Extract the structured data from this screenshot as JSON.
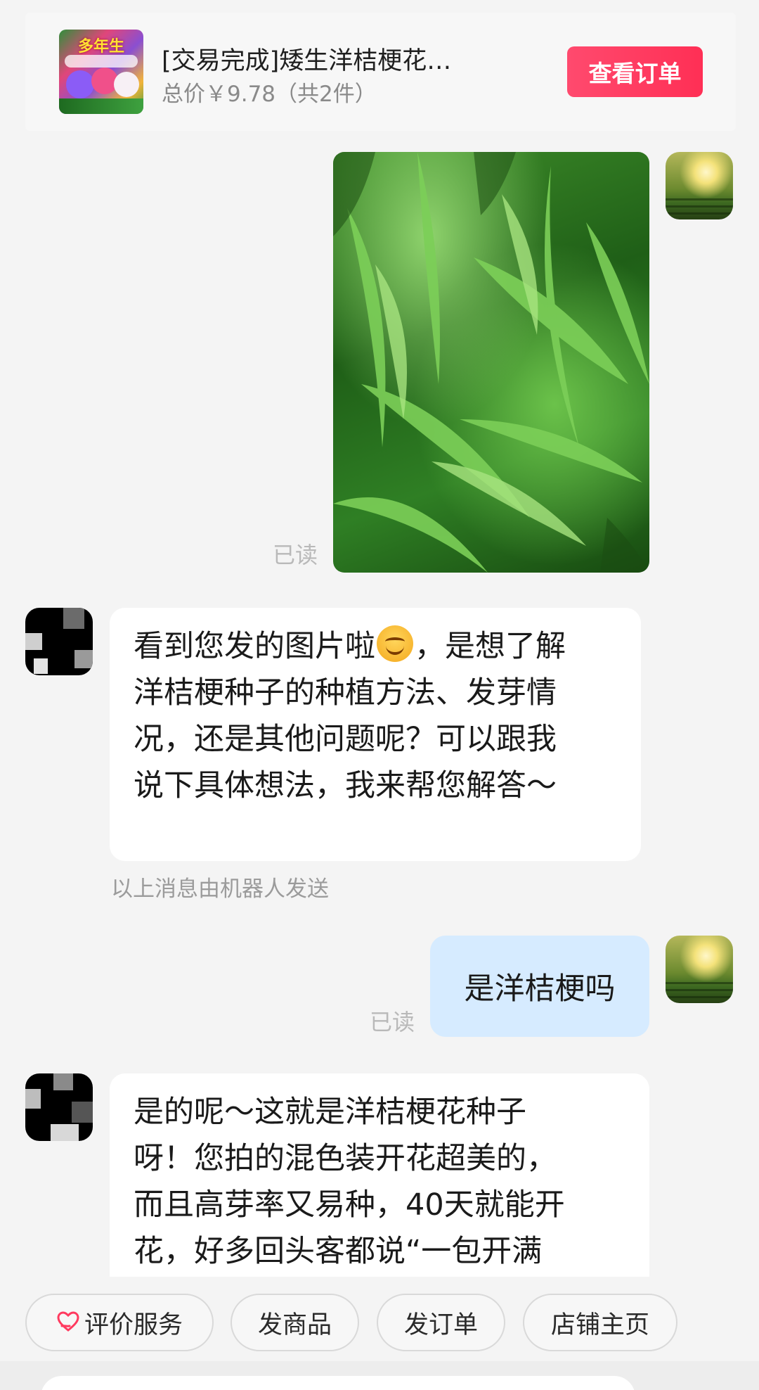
{
  "order": {
    "thumb_text": "多年生",
    "title": "[交易完成]矮生洋桔梗花…",
    "price": "总价￥9.78（共2件）",
    "view_button": "查看订单"
  },
  "messages": {
    "read_1": "已读",
    "bot_reply_1": {
      "line1_a": "看到您发的图片啦",
      "line1_b": "，是想了解",
      "line2": "洋桔梗种子的种植方法、发芽情",
      "line3": "况，还是其他问题呢？可以跟我",
      "line4": "说下具体想法，我来帮您解答～"
    },
    "robot_note": "以上消息由机器人发送",
    "user_text": "是洋桔梗吗",
    "read_2": "已读",
    "bot_reply_2": {
      "line1": "是的呢～这就是洋桔梗花种子",
      "line2": "呀！您拍的混色装开花超美的，",
      "line3": "而且高芽率又易种，40天就能开",
      "line4": "花，好多回头客都说“一包开满"
    }
  },
  "quick_actions": {
    "rate_service": "评价服务",
    "send_product": "发商品",
    "send_order": "发订单",
    "shop_home": "店铺主页"
  },
  "icons": {
    "rate_service": "heart-hand-icon",
    "emoji": "smiling-face-icon"
  },
  "colors": {
    "accent": "#ff3a5f",
    "user_bubble": "#d6ebff",
    "background": "#f4f4f4"
  }
}
